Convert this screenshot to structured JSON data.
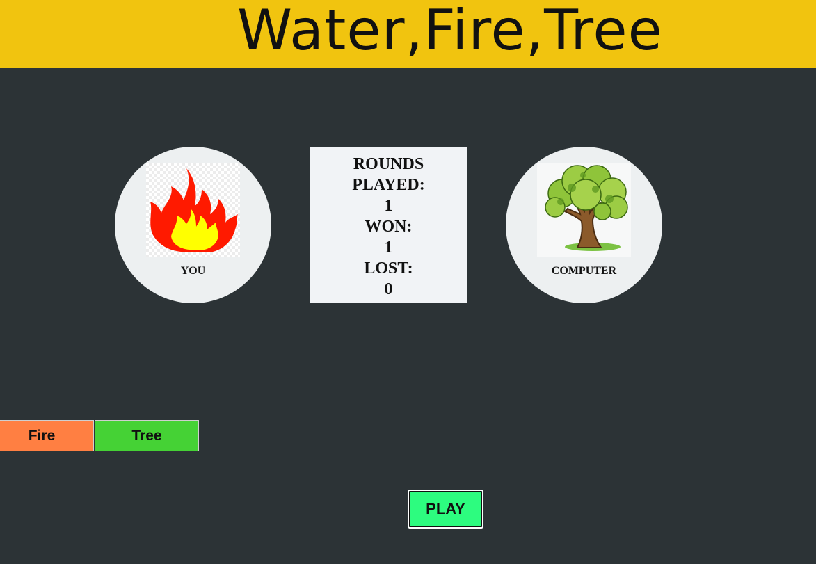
{
  "header": {
    "title": "Water,Fire,Tree",
    "background_color": "#f1c40f"
  },
  "player": {
    "label": "YOU",
    "choice_icon": "fire-icon"
  },
  "computer": {
    "label": "COMPUTER",
    "choice_icon": "tree-icon"
  },
  "scoreboard": {
    "rounds_label_line1": "ROUNDS",
    "rounds_label_line2": "PLAYED:",
    "rounds_value": "1",
    "won_label": "WON:",
    "won_value": "1",
    "lost_label": "LOST:",
    "lost_value": "0"
  },
  "choices": {
    "fire_label": "Fire",
    "tree_label": "Tree",
    "fire_color": "#ff7f42",
    "tree_color": "#45d235"
  },
  "play_button": {
    "label": "PLAY",
    "color": "#2dfc7f"
  },
  "colors": {
    "page_background": "#2c3336",
    "circle_background": "#edf0f1",
    "scoreboard_background": "#f1f3f6"
  }
}
